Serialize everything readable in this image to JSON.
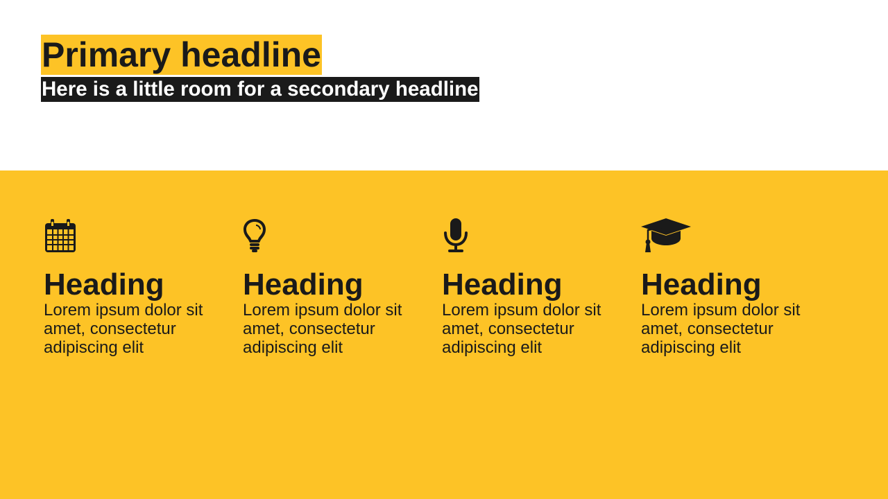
{
  "colors": {
    "accent": "#FDC326",
    "dark": "#1a1a1a",
    "light": "#ffffff"
  },
  "header": {
    "primary": "Primary headline",
    "secondary": "Here is a little room for a secondary headline"
  },
  "features": [
    {
      "icon": "calendar-icon",
      "heading": "Heading",
      "body": "Lorem ipsum dolor sit amet, consectetur adipiscing elit"
    },
    {
      "icon": "lightbulb-icon",
      "heading": "Heading",
      "body": "Lorem ipsum dolor sit amet, consectetur adipiscing elit"
    },
    {
      "icon": "microphone-icon",
      "heading": "Heading",
      "body": "Lorem ipsum dolor sit amet, consectetur adipiscing elit"
    },
    {
      "icon": "graduation-cap-icon",
      "heading": "Heading",
      "body": "Lorem ipsum dolor sit amet, consectetur adipiscing elit"
    }
  ]
}
